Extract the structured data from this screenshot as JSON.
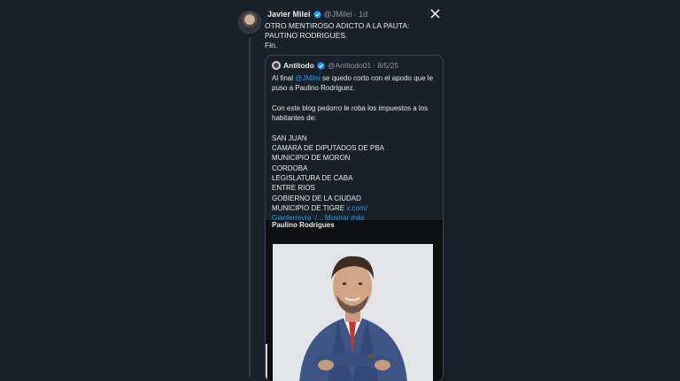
{
  "tweet": {
    "author_name": "Javier Milei",
    "handle": "@JMilei",
    "time": "· 1d",
    "close_icon": "x-logo-icon",
    "lines": [
      "OTRO MENTIROSO ADICTO A LA PAUTA:",
      "PAUTINO RODRIGUES.",
      "Fin."
    ]
  },
  "quote": {
    "author_name": "Antitodo",
    "handle": "@Antitodo01",
    "time": "· 8/5/25",
    "intro_before_mention": "Al final ",
    "mention": "@JMilei",
    "intro_after_mention": " se quedo corto con el apodo que le puso a Paulino Rodriguez.",
    "paragraph2": "Con este blog pedorro le roba los impuestos a los habitantes de:",
    "places": [
      "SAN JUAN",
      "CAMARA DE DIPUTADOS DE PBA",
      "MUNICIPIO DE MORON",
      "CORDOBA",
      "LEGISLATURA DE CABA",
      "ENTRE RIOS",
      "GOBIERNO DE LA CIUDAD"
    ],
    "last_place": "MUNICIPIO DE TIGRE ",
    "link_part1": "x.com/",
    "link_part2": "Gianferreyra_/...",
    "show_more": " Mostrar más",
    "media_caption": "Paulino Rodrigues"
  },
  "colors": {
    "background": "#18202a",
    "link": "#1d9bf0",
    "verified": "#1d9bf0",
    "muted": "#8b98a5"
  }
}
